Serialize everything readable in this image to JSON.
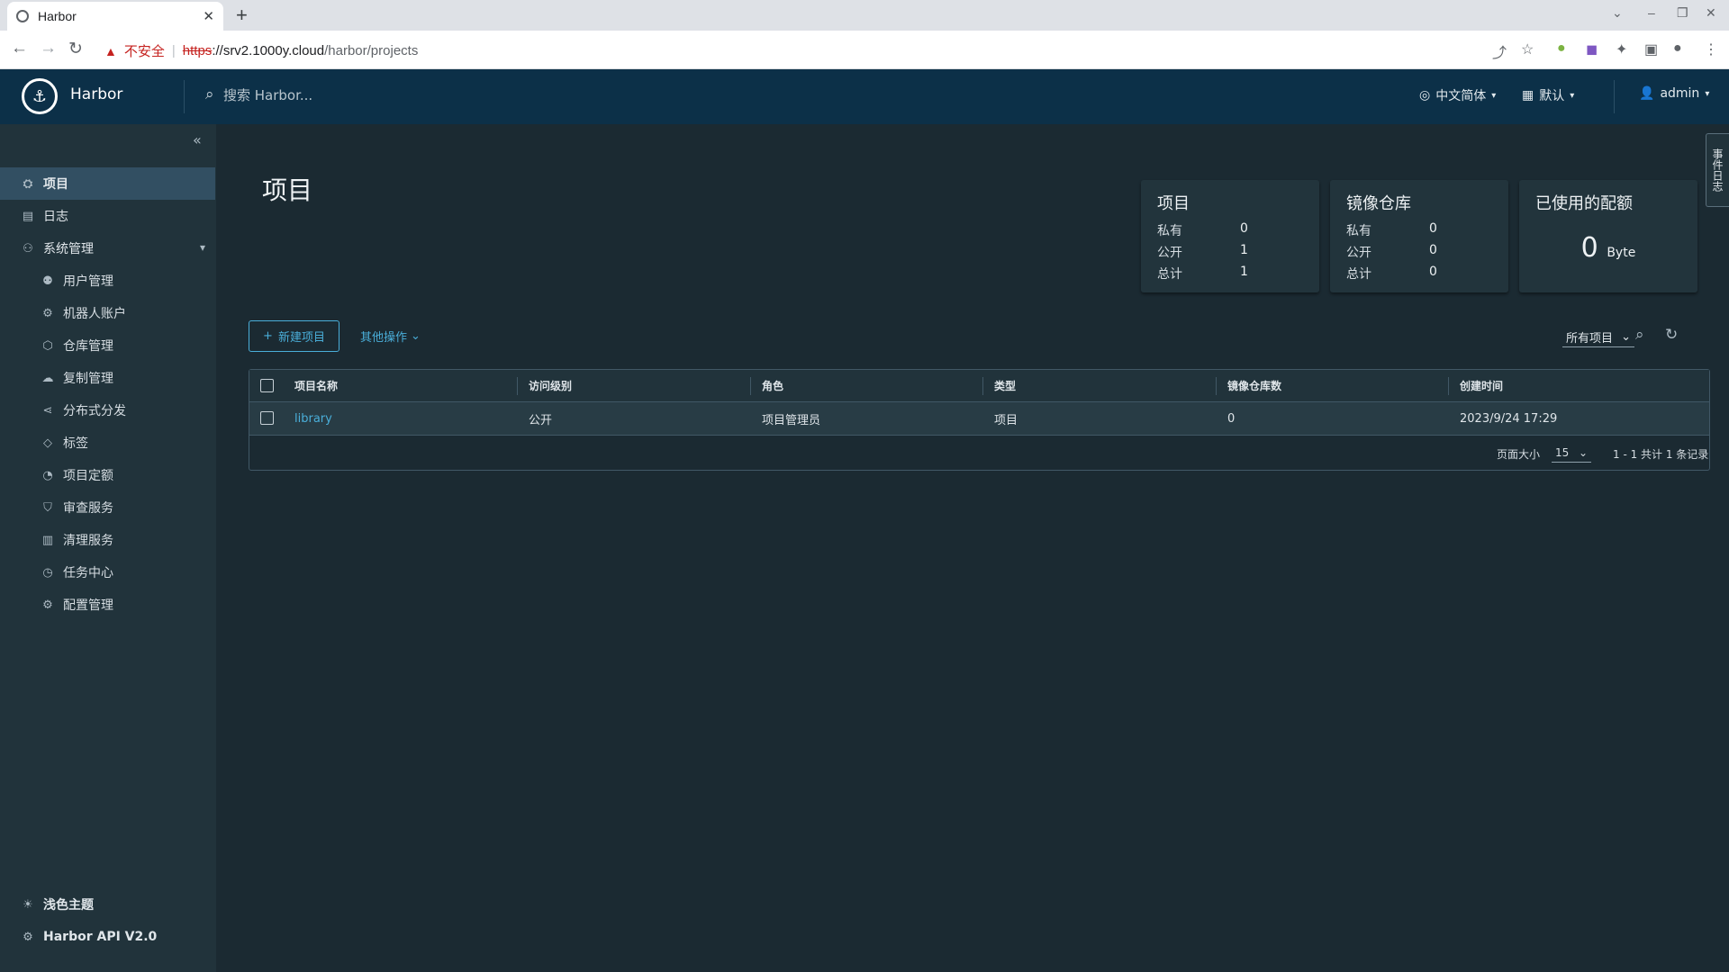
{
  "browser": {
    "tab_title": "Harbor",
    "new_tab": "+",
    "window_controls": [
      "⌄",
      "–",
      "❐",
      "✕"
    ],
    "insecure_label": "不安全",
    "url_scheme": "https",
    "url_host_path": "://srv2.1000y.cloud",
    "url_path": "/harbor/projects"
  },
  "header": {
    "brand": "Harbor",
    "search_placeholder": "搜索 Harbor...",
    "language": "中文简体",
    "date_format": "默认",
    "user": "admin"
  },
  "sidebar": {
    "items": [
      {
        "label": "项目",
        "icon": "projects-icon"
      },
      {
        "label": "日志",
        "icon": "logs-icon"
      },
      {
        "label": "系统管理",
        "icon": "admin-icon"
      }
    ],
    "sub_items": [
      {
        "label": "用户管理",
        "icon": "users-icon"
      },
      {
        "label": "机器人账户",
        "icon": "robot-icon"
      },
      {
        "label": "仓库管理",
        "icon": "registry-icon"
      },
      {
        "label": "复制管理",
        "icon": "replication-icon"
      },
      {
        "label": "分布式分发",
        "icon": "distribution-icon"
      },
      {
        "label": "标签",
        "icon": "tag-icon"
      },
      {
        "label": "项目定额",
        "icon": "quota-icon"
      },
      {
        "label": "审查服务",
        "icon": "shield-icon"
      },
      {
        "label": "清理服务",
        "icon": "trash-icon"
      },
      {
        "label": "任务中心",
        "icon": "dashboard-icon"
      },
      {
        "label": "配置管理",
        "icon": "gear-icon"
      }
    ],
    "theme": "浅色主题",
    "api": "Harbor API V2.0"
  },
  "main": {
    "title": "项目",
    "cards": {
      "projects": {
        "title": "项目",
        "private_label": "私有",
        "private": "0",
        "public_label": "公开",
        "public": "1",
        "total_label": "总计",
        "total": "1"
      },
      "repos": {
        "title": "镜像仓库",
        "private_label": "私有",
        "private": "0",
        "public_label": "公开",
        "public": "0",
        "total_label": "总计",
        "total": "0"
      },
      "quota": {
        "title": "已使用的配额",
        "value": "0",
        "unit": "Byte"
      }
    },
    "new_project": "新建项目",
    "other_actions": "其他操作",
    "filter": "所有项目",
    "table": {
      "columns": [
        "项目名称",
        "访问级别",
        "角色",
        "类型",
        "镜像仓库数",
        "创建时间"
      ],
      "rows": [
        {
          "name": "library",
          "access": "公开",
          "role": "项目管理员",
          "type": "项目",
          "repo_count": "0",
          "created": "2023/9/24 17:29"
        }
      ],
      "page_size_label": "页面大小",
      "page_size": "15",
      "summary": "1 - 1 共计 1 条记录"
    },
    "event_tab": "事件日志"
  }
}
